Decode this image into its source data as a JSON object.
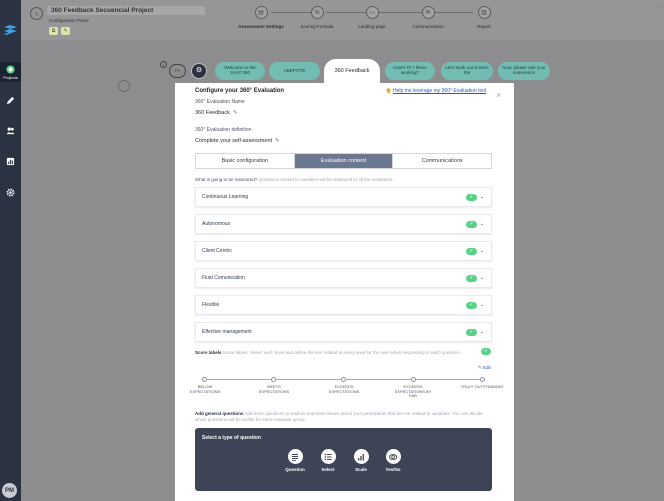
{
  "rail": {
    "items": [
      {
        "name": "rail-item-projects",
        "icon": "target-icon",
        "label": "Projects",
        "active": true
      },
      {
        "name": "rail-item-edit",
        "icon": "pencil-icon",
        "label": ""
      },
      {
        "name": "rail-item-people",
        "icon": "users-icon",
        "label": ""
      },
      {
        "name": "rail-item-reports",
        "icon": "bar-chart-icon",
        "label": ""
      },
      {
        "name": "rail-item-settings",
        "icon": "gear-icon",
        "label": ""
      }
    ],
    "avatar": "PM"
  },
  "header": {
    "project_title": "360 Feedback Secuencial Project",
    "project_sub": "Configuration Panel",
    "steps": [
      {
        "label": "Assessment Settings",
        "bold": true
      },
      {
        "label": "Scoring Formula",
        "bold": false
      },
      {
        "label": "Landing page",
        "bold": false
      },
      {
        "label": "Communication",
        "bold": false
      },
      {
        "label": "Report",
        "bold": false
      }
    ]
  },
  "tabs": {
    "tf_chip": "T.F.",
    "pills": [
      "Welcome to the SAAT 360",
      "ABEPT/TE",
      "360 Feedback",
      "How's TF t these working?",
      "Let's work out & learn the",
      "Now, please rate your experience"
    ],
    "active_index": 2
  },
  "modal": {
    "title": "Configure your 360° Evaluation",
    "help_link": "Help me leverage my 360° Evaluation tool",
    "name_label": "360° Evaluation Name",
    "name_value": "360 Feedback",
    "definition_label": "360° Evaluation definition",
    "definition_value": "Complete your self-assessment",
    "segments": [
      "Basic configuration",
      "Evaluation content",
      "Communications"
    ],
    "active_segment": 1,
    "measure_label": "What is going to be measured?",
    "measure_hint": "Questions related to variables will be displayed to all the evaluators.",
    "competencies": [
      "Continuous Learning",
      "Autonomous",
      "Client Centric",
      "Fluid Comunication",
      "Flexible",
      "Effective management"
    ],
    "score_label": "Score labels",
    "score_hint": "Score labels. Select each level and define the text related to every level for the user when responding to each question.",
    "edit_label": "Edit",
    "scale_levels": [
      "BELOW EXPECTATIONS",
      "MEETS EXPECTATIONS",
      "EXCEEDS EXPECTATIONS",
      "EXCEEDS EXPECTATIONS BY FAR",
      "TRULY OUTSTANDING"
    ],
    "general_label": "Add general questions",
    "general_hint": "Add more questions to explore important issues about your participants that are not related to variables. You can decide which questions will be visible for each evaluator group.",
    "question_panel_title": "Select a type of question",
    "question_types": [
      {
        "label": "Question",
        "icon": "paragraph-icon"
      },
      {
        "label": "Select",
        "icon": "list-icon"
      },
      {
        "label": "Scale",
        "icon": "bar-chart-icon"
      },
      {
        "label": "Yes/No",
        "icon": "toggle-icon"
      }
    ]
  },
  "colors": {
    "rail": "#2b3242",
    "overlay": "#8d8d8f",
    "accent_teal": "#73bcb2",
    "segment_active": "#6b7890",
    "check_green": "#5ad186",
    "panel_dark": "#3d4456",
    "link_blue": "#2a56c6"
  }
}
